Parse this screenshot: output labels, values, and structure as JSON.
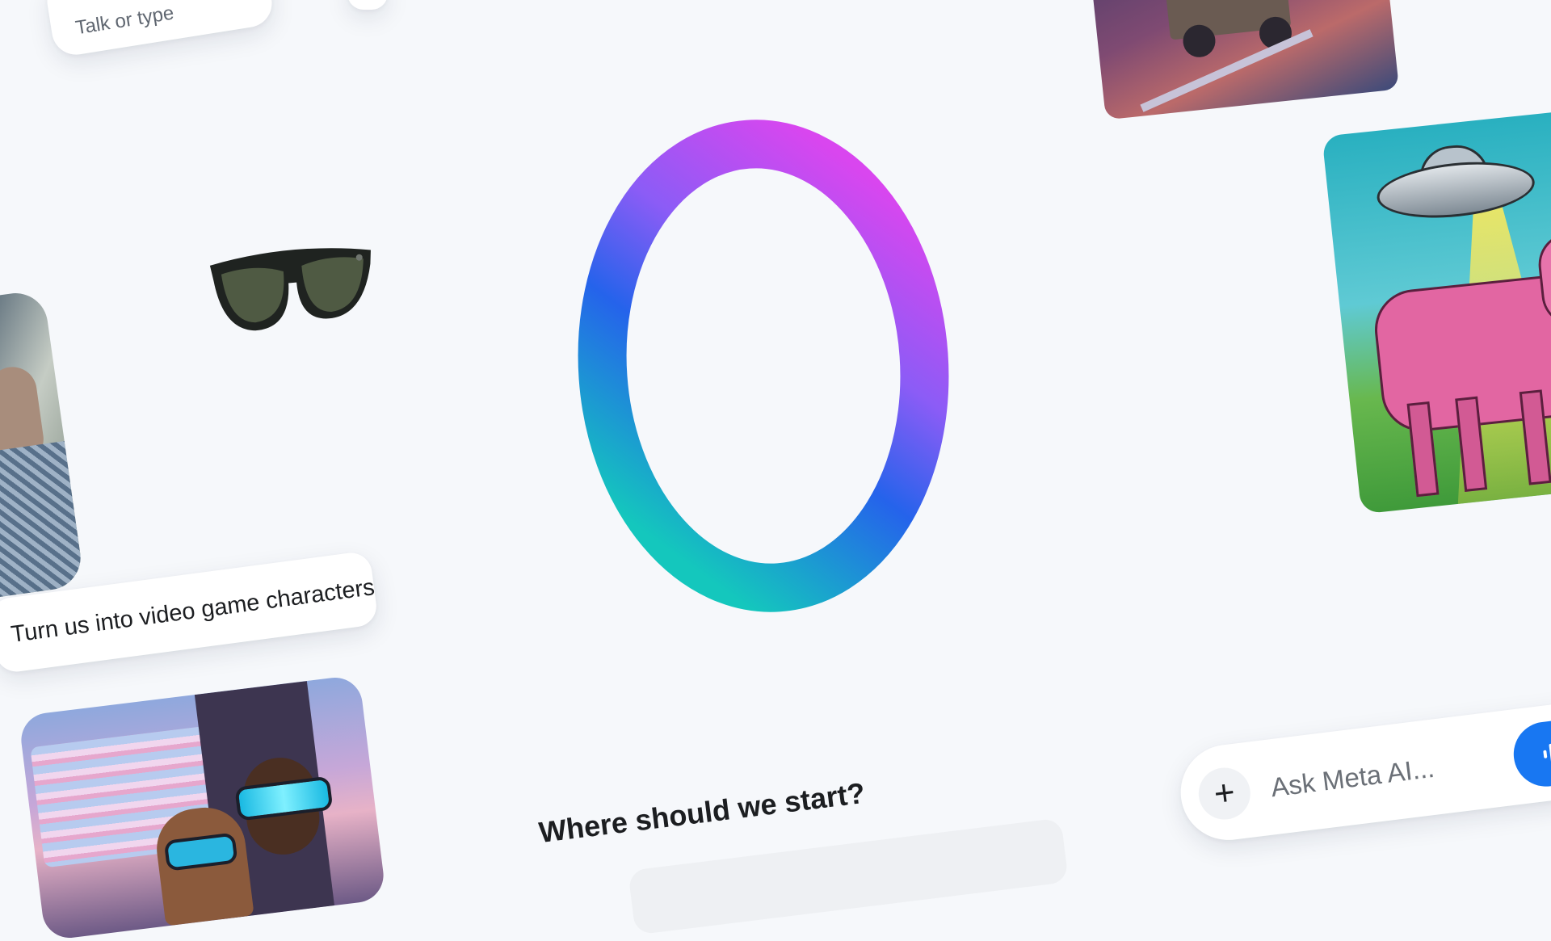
{
  "pills": {
    "talk_or_type": "Talk or type",
    "video_game": "Turn us into video game characters"
  },
  "main": {
    "title": "Where should we start?"
  },
  "composer": {
    "placeholder": "Ask Meta AI...",
    "plus_icon": "plus-icon",
    "voice_icon": "voice-waveform-icon"
  },
  "colors": {
    "background": "#f6f8fb",
    "accent": "#1877f2",
    "ring_gradient": [
      "#d946ef",
      "#2563eb",
      "#14c7bd"
    ]
  }
}
